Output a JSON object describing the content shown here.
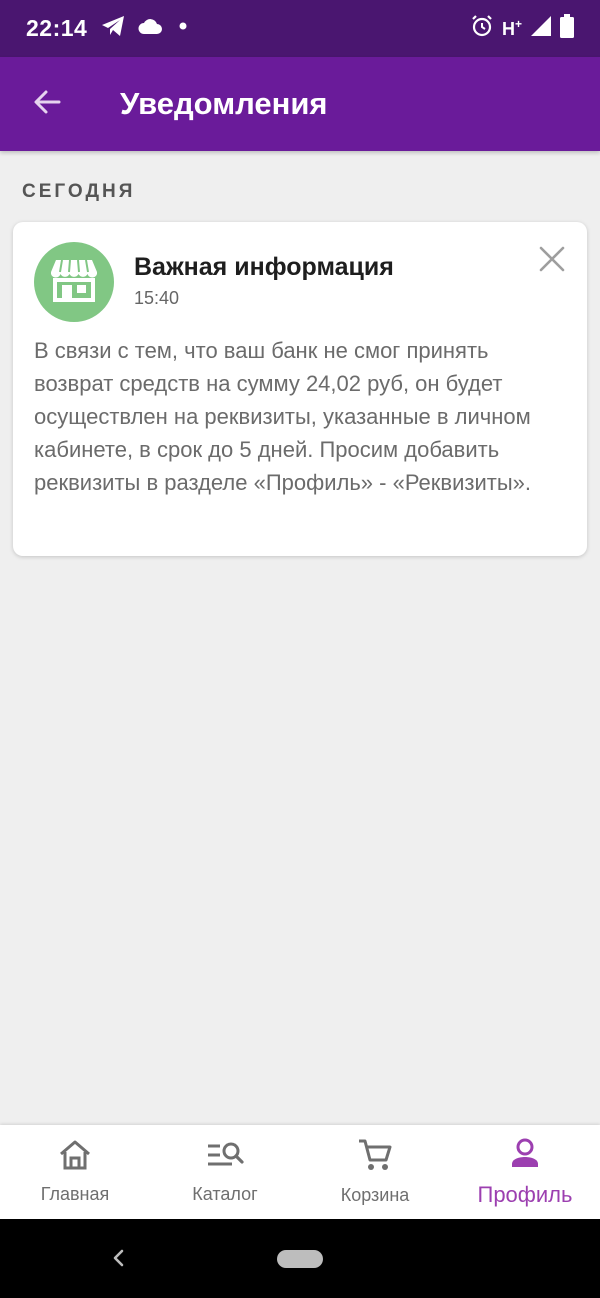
{
  "status_bar": {
    "time": "22:14",
    "network": "H",
    "network_sup": "+",
    "icons": [
      "telegram-icon",
      "cloud-icon",
      "dot-icon",
      "alarm-icon",
      "signal-icon",
      "battery-icon"
    ]
  },
  "app_bar": {
    "title": "Уведомления",
    "back_icon": "arrow-back-icon"
  },
  "section": {
    "label": "СЕГОДНЯ"
  },
  "notification": {
    "title": "Важная информация",
    "time": "15:40",
    "body": "В связи с тем, что ваш банк не смог принять возврат средств на сумму 24,02 руб, он будет осуществлен на реквизиты, указанные в личном кабинете, в срок до 5 дней. Просим добавить реквизиты в разделе «Профиль» - «Реквизиты».",
    "avatar_icon": "store-icon",
    "avatar_color": "#81c784"
  },
  "bottom_nav": {
    "items": [
      {
        "label": "Главная",
        "icon": "home-icon"
      },
      {
        "label": "Каталог",
        "icon": "catalog-search-icon"
      },
      {
        "label": "Корзина",
        "icon": "cart-icon"
      },
      {
        "label": "Профиль",
        "icon": "person-icon",
        "active": true
      }
    ]
  },
  "colors": {
    "status_bar": "#4a1670",
    "app_bar": "#6a1b9a",
    "accent": "#9c3fb0",
    "background": "#efefef"
  }
}
